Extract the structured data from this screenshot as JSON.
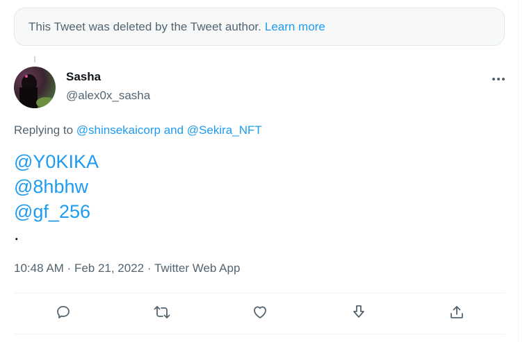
{
  "deleted_notice": {
    "text": "This Tweet was deleted by the Tweet author.",
    "learn_more": "Learn more"
  },
  "author": {
    "name": "Sasha",
    "handle": "@alex0x_sasha"
  },
  "reply": {
    "prefix": "Replying to ",
    "to_1": "@shinsekaicorp",
    "joiner": " and ",
    "to_2": "@Sekira_NFT"
  },
  "body": {
    "mentions": [
      "@Y0KIKA",
      "@8hbhw",
      "@gf_256"
    ],
    "trailing": "."
  },
  "meta": {
    "time": "10:48 AM",
    "sep": " · ",
    "date": "Feb 21, 2022",
    "app": "Twitter Web App"
  },
  "icons": {
    "more": "more-icon",
    "reply": "reply-icon",
    "retweet": "retweet-icon",
    "like": "like-icon",
    "bookmark": "bookmark-icon",
    "share": "share-icon"
  },
  "colors": {
    "accent": "#1d9bf0",
    "secondary_text": "#536471",
    "primary_text": "#0f1419",
    "border": "#eff3f4"
  }
}
